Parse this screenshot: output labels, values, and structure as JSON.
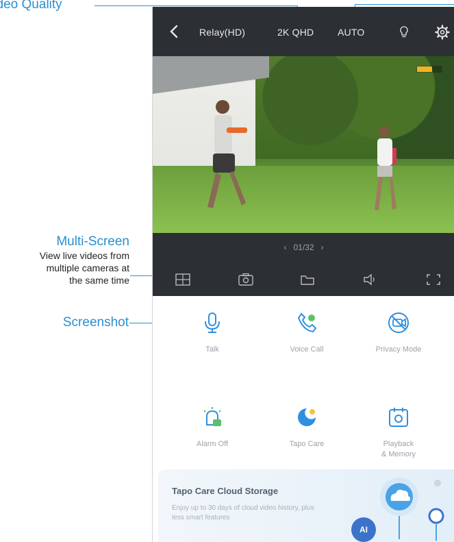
{
  "callouts": {
    "video_quality": "Video Quality",
    "multi_screen_title": "Multi-Screen",
    "multi_screen_desc_1": "View live videos from",
    "multi_screen_desc_2": "multiple cameras at",
    "multi_screen_desc_3": "the same time",
    "screenshot": "Screenshot"
  },
  "topbar": {
    "stream": "Relay(HD)",
    "quality": "2K QHD",
    "mode": "AUTO"
  },
  "controlbar": {
    "pager": "01/32"
  },
  "features": [
    {
      "label": "Talk",
      "icon": "microphone-icon"
    },
    {
      "label": "Voice Call",
      "icon": "phone-icon"
    },
    {
      "label": "Privacy Mode",
      "icon": "privacy-camera-icon"
    },
    {
      "label": "Alarm Off",
      "icon": "alarm-light-icon"
    },
    {
      "label": "Tapo Care",
      "icon": "tapo-care-icon"
    },
    {
      "label": "Playback",
      "label2": "& Memory",
      "icon": "playback-icon"
    }
  ],
  "banner": {
    "title": "Tapo Care Cloud Storage",
    "desc": "Enjoy up to 30 days of cloud video history, plus less smart features",
    "badge": "AI"
  },
  "colors": {
    "accent": "#2a8fd0",
    "bar": "#2c2f33",
    "icon_blue": "#2f8fe0",
    "icon_green": "#5cc06a"
  }
}
